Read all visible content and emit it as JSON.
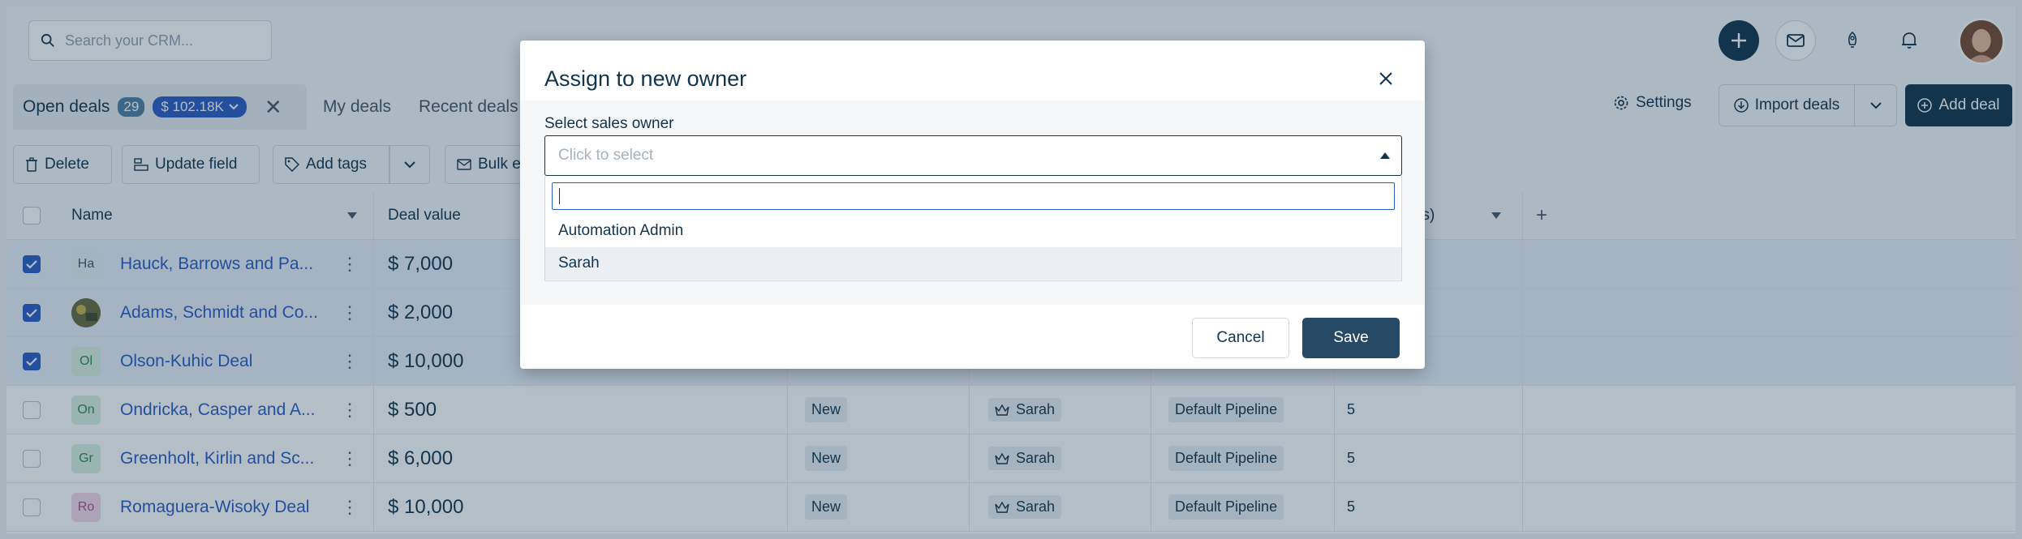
{
  "search": {
    "placeholder": "Search your CRM..."
  },
  "views": {
    "active_tab": "Open deals",
    "active_count": "29",
    "active_value": "$ 102.18K",
    "tabs": [
      "My deals",
      "Recent deals"
    ]
  },
  "header_actions": {
    "settings": "Settings",
    "import": "Import deals",
    "add": "Add deal"
  },
  "bulk_actions": {
    "delete": "Delete",
    "update_field": "Update field",
    "add_tags": "Add tags",
    "bulk_email": "Bulk e"
  },
  "table": {
    "columns": {
      "name": "Name",
      "deal_value": "Deal value",
      "days_col": "ys)"
    },
    "rows": [
      {
        "initials": "Ha",
        "name": "Hauck, Barrows and Pa...",
        "value": "$ 7,000",
        "checked": true,
        "avatar_bg": "#ebeff3",
        "avatar_fg": "#475867"
      },
      {
        "initials": "",
        "name": "Adams, Schmidt and Co...",
        "value": "$ 2,000",
        "checked": true,
        "avatar_bg": "#8a8a5c",
        "avatar_fg": "#fff"
      },
      {
        "initials": "Ol",
        "name": "Olson-Kuhic Deal",
        "value": "$ 10,000",
        "checked": true,
        "avatar_bg": "#d9f0e1",
        "avatar_fg": "#2f8a4f"
      },
      {
        "initials": "On",
        "name": "Ondricka, Casper and A...",
        "value": "$ 500",
        "checked": false,
        "avatar_bg": "#d9f0e1",
        "avatar_fg": "#2f8a4f",
        "stage": "New",
        "owner": "Sarah",
        "pipeline": "Default Pipeline",
        "days": "5"
      },
      {
        "initials": "Gr",
        "name": "Greenholt, Kirlin and Sc...",
        "value": "$ 6,000",
        "checked": false,
        "avatar_bg": "#d9f0e1",
        "avatar_fg": "#2f8a4f",
        "stage": "New",
        "owner": "Sarah",
        "pipeline": "Default Pipeline",
        "days": "5"
      },
      {
        "initials": "Ro",
        "name": "Romaguera-Wisoky Deal",
        "value": "$ 10,000",
        "checked": false,
        "avatar_bg": "#f6d8ea",
        "avatar_fg": "#b04a86",
        "stage": "New",
        "owner": "Sarah",
        "pipeline": "Default Pipeline",
        "days": "5"
      }
    ]
  },
  "modal": {
    "title": "Assign to new owner",
    "field_label": "Select sales owner",
    "select_placeholder": "Click to select",
    "options": [
      "Automation Admin",
      "Sarah"
    ],
    "highlighted_option": "Sarah",
    "cancel": "Cancel",
    "save": "Save"
  },
  "colors": {
    "primary": "#12344d",
    "link": "#2c5cc5",
    "save_button": "#264966"
  }
}
